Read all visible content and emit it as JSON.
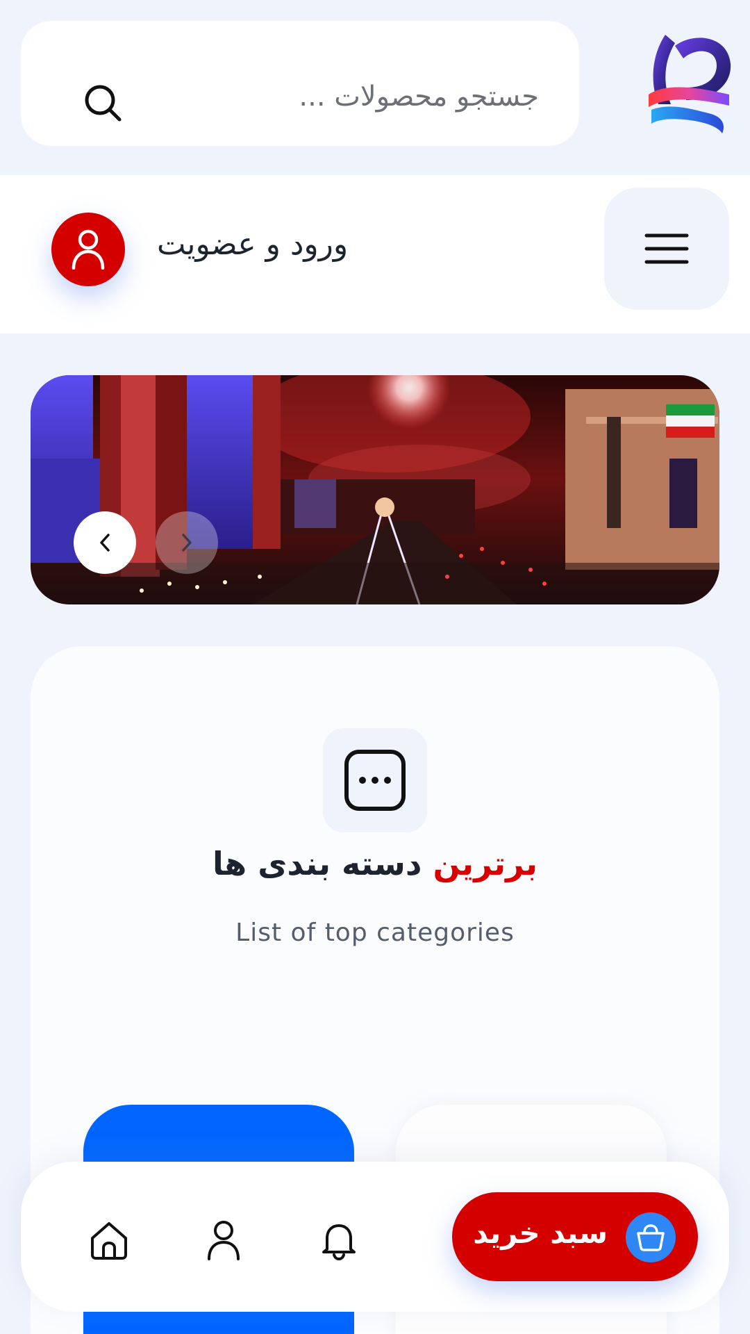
{
  "search": {
    "placeholder": "جستجو محصولات ..."
  },
  "header": {
    "login_label": "ورود و عضویت"
  },
  "banner": {
    "alt": "banner-slide-city-night"
  },
  "categories": {
    "title_accent": "برترین",
    "title_rest": "دسته بندی ها",
    "subtitle": "List of top categories"
  },
  "bottom_nav": {
    "cart_label": "سبد خرید"
  },
  "colors": {
    "accent_red": "#d40000",
    "accent_blue": "#0066ff",
    "background": "#eef3fc"
  }
}
